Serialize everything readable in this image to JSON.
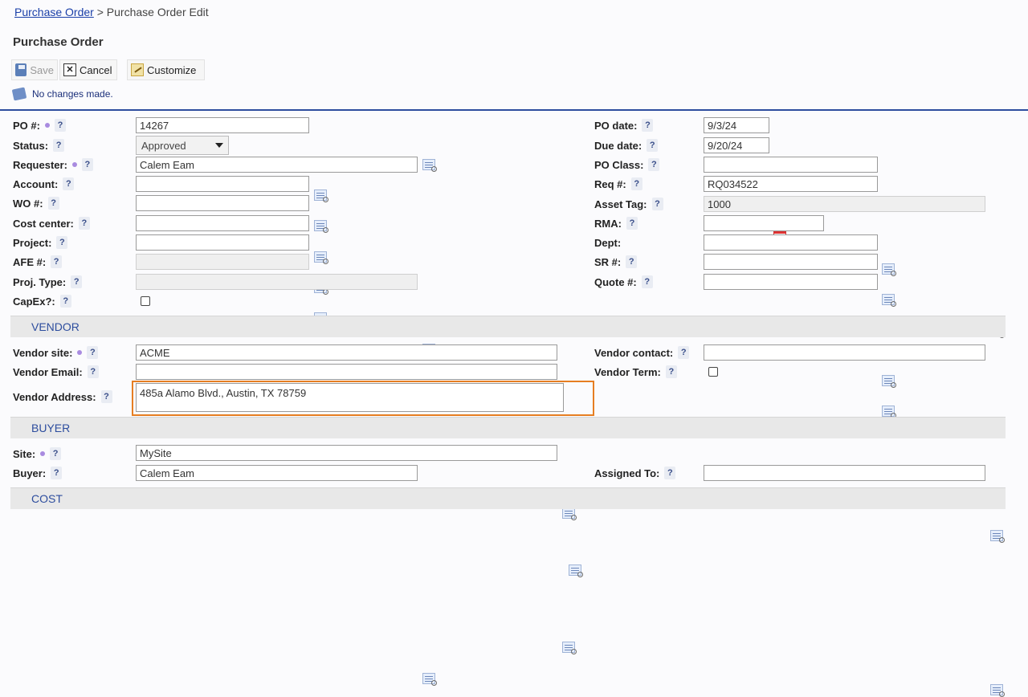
{
  "breadcrumb": {
    "link": "Purchase Order",
    "sep": " > ",
    "current": "Purchase Order Edit"
  },
  "page_title": "Purchase Order",
  "toolbar": {
    "save": "Save",
    "cancel": "Cancel",
    "customize": "Customize"
  },
  "message": "No changes made.",
  "fields": {
    "po_num": {
      "label": "PO #:",
      "value": "14267"
    },
    "status": {
      "label": "Status:",
      "value": "Approved"
    },
    "requester": {
      "label": "Requester:",
      "value": "Calem Eam"
    },
    "account": {
      "label": "Account:",
      "value": ""
    },
    "wo_num": {
      "label": "WO #:",
      "value": ""
    },
    "cost_center": {
      "label": "Cost center:",
      "value": ""
    },
    "project": {
      "label": "Project:",
      "value": ""
    },
    "afe_num": {
      "label": "AFE #:",
      "value": ""
    },
    "proj_type": {
      "label": "Proj. Type:",
      "value": ""
    },
    "capex": {
      "label": "CapEx?:",
      "checked": false
    },
    "po_date": {
      "label": "PO date:",
      "value": "9/3/24"
    },
    "due_date": {
      "label": "Due date:",
      "value": "9/20/24"
    },
    "po_class": {
      "label": "PO Class:",
      "value": ""
    },
    "req_num": {
      "label": "Req #:",
      "value": "RQ034522"
    },
    "asset_tag": {
      "label": "Asset Tag:",
      "value": "1000"
    },
    "rma": {
      "label": "RMA:",
      "value": ""
    },
    "dept": {
      "label": "Dept:",
      "value": ""
    },
    "sr_num": {
      "label": "SR #:",
      "value": ""
    },
    "quote_num": {
      "label": "Quote #:",
      "value": ""
    }
  },
  "sections": {
    "vendor": "VENDOR",
    "buyer": "BUYER",
    "cost": "COST"
  },
  "vendor": {
    "site": {
      "label": "Vendor site:",
      "value": "ACME"
    },
    "email": {
      "label": "Vendor Email:",
      "value": ""
    },
    "address": {
      "label": "Vendor Address:",
      "value": "485a Alamo Blvd., Austin, TX 78759"
    },
    "contact": {
      "label": "Vendor contact:",
      "value": ""
    },
    "term": {
      "label": "Vendor Term:",
      "checked": false
    }
  },
  "buyer": {
    "site": {
      "label": "Site:",
      "value": "MySite"
    },
    "buyer": {
      "label": "Buyer:",
      "value": "Calem Eam"
    },
    "assigned_to": {
      "label": "Assigned To:",
      "value": ""
    }
  },
  "help_glyph": "?",
  "colors": {
    "accent": "#2d4d9e",
    "highlight": "#e67e22",
    "required_dot": "#a98be0"
  }
}
